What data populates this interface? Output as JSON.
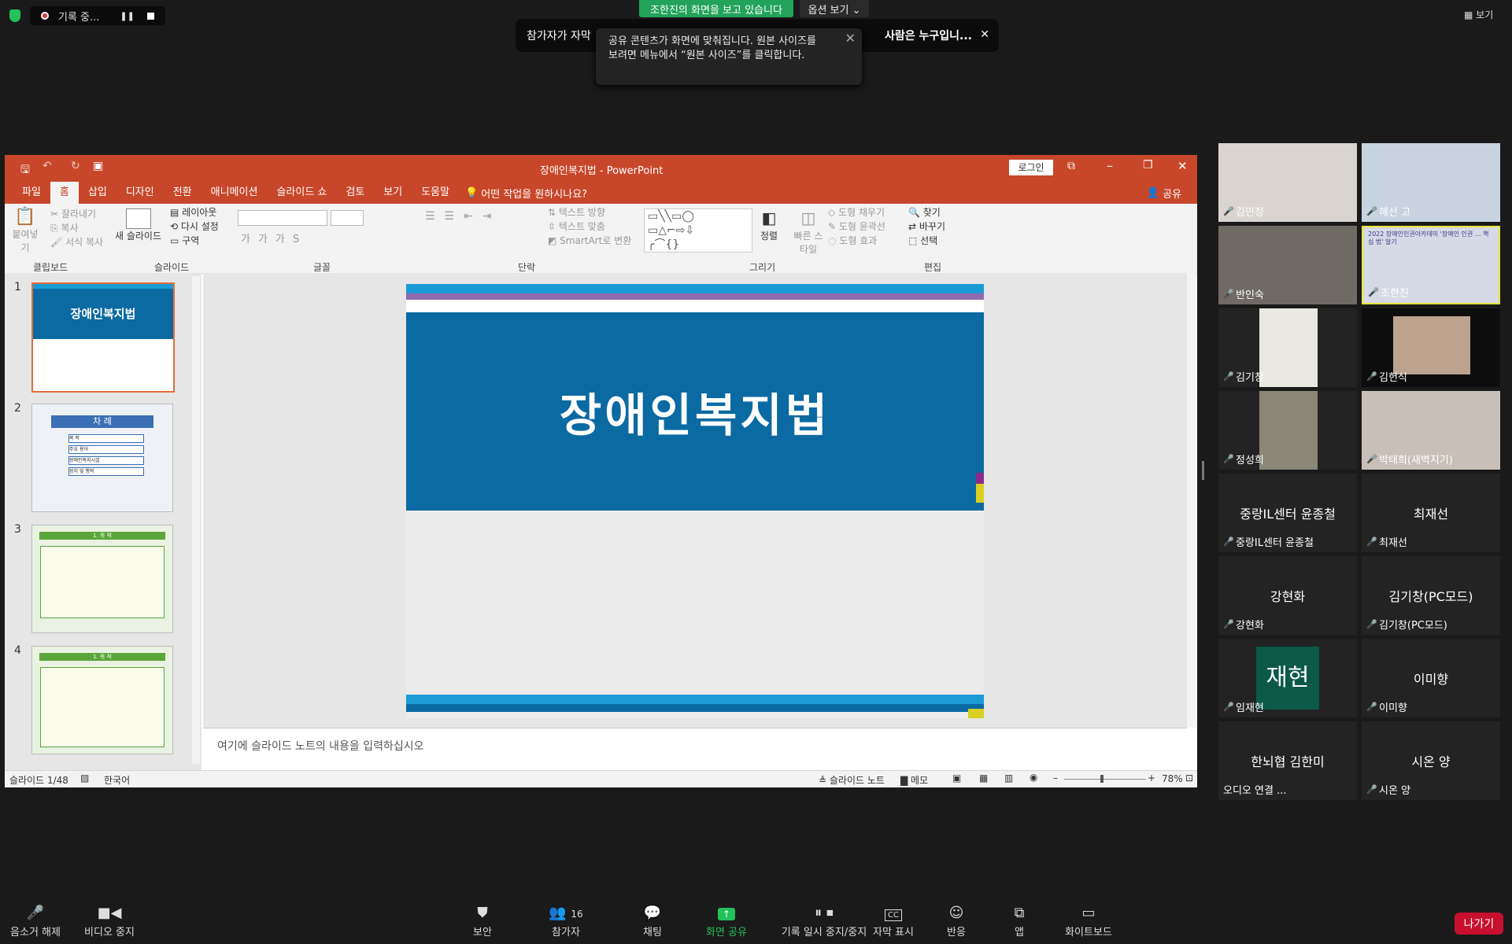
{
  "zoom_top": {
    "recording_label": "기록 중...",
    "viewing_banner": "조한진의 화면을 보고 있습니다",
    "view_options": "옵션 보기 ⌄",
    "view_label": "보기",
    "caption_left": "참가자가 자막",
    "caption_right": "사람은 누구입니...",
    "toast_line1": "공유 콘텐츠가 화면에 맞춰집니다. 원본 사이즈를",
    "toast_line2": "보려면 메뉴에서 “원본 사이즈”를 클릭합니다."
  },
  "ppt": {
    "window_title": "장애인복지법  -  PowerPoint",
    "login_button": "로그인",
    "share_label": "공유",
    "tabs": [
      "파일",
      "홈",
      "삽입",
      "디자인",
      "전환",
      "애니메이션",
      "슬라이드 쇼",
      "검토",
      "보기",
      "도움말"
    ],
    "tell_me": "어떤 작업을 원하시나요?",
    "ribbon": {
      "paste": "붙여넣기",
      "cut": "잘라내기",
      "copy": "복사",
      "format_painter": "서식 복사",
      "new_slide": "새 슬라이드",
      "layout": "레이아웃",
      "reset": "다시 설정",
      "section": "구역",
      "text_direction": "텍스트 방향",
      "align_text": "텍스트 맞춤",
      "smartart": "SmartArt로 변환",
      "arrange": "정렬",
      "quick_styles": "빠른 스타일",
      "shape_fill": "도형 채우기",
      "shape_outline": "도형 윤곽선",
      "shape_effects": "도형 효과",
      "find": "찾기",
      "replace": "바꾸기",
      "select": "선택",
      "groups": [
        "클립보드",
        "슬라이드",
        "글꼴",
        "단락",
        "그리기",
        "편집"
      ]
    },
    "thumbnails": [
      {
        "num": "1",
        "title": "장애인복지법"
      },
      {
        "num": "2",
        "title": "차 례",
        "items": [
          "목 적",
          "주요 용어",
          "장애인복지시설",
          "장치 및 행적"
        ]
      },
      {
        "num": "3",
        "title": "1. 목 적"
      },
      {
        "num": "4",
        "title": "1. 목 적"
      }
    ],
    "slide_title": "장애인복지법",
    "notes_placeholder": "여기에 슬라이드 노트의 내용을 입력하십시오",
    "status_slide": "슬라이드 1/48",
    "status_lang": "한국어",
    "status_notes": "슬라이드 노트",
    "status_memo": "메모",
    "zoom_level": "78%"
  },
  "participants": [
    {
      "name": "김민정",
      "type": "video",
      "bg": "#d9d4cf"
    },
    {
      "name": "혜선 고",
      "type": "video",
      "bg": "#c7d4e0"
    },
    {
      "name": "반인숙",
      "type": "video",
      "bg": "#6f6a64"
    },
    {
      "name": "조한진",
      "type": "video",
      "bg": "#d6d9e6",
      "active": true,
      "banner": "2022 장애인인권아카데미 '장애인 인권 ... 핵심 법' 알기"
    },
    {
      "name": "김기창",
      "type": "video",
      "bg": "#e8e8e0"
    },
    {
      "name": "김헌식",
      "type": "video",
      "bg": "#bba38e"
    },
    {
      "name": "정성희",
      "type": "video",
      "bg": "#8a8678"
    },
    {
      "name": "박태희(새벽지기)",
      "type": "video",
      "bg": "#c8c0b8"
    },
    {
      "name": "중랑IL센터 윤종철",
      "type": "name",
      "display": "중랑IL센터 윤종철"
    },
    {
      "name": "최재선",
      "type": "name",
      "display": "최재선"
    },
    {
      "name": "강현화",
      "type": "name",
      "display": "강현화"
    },
    {
      "name": "김기창(PC모드)",
      "type": "name",
      "display": "김기창(PC모드)"
    },
    {
      "name": "임재현",
      "type": "avatar",
      "display": "재현"
    },
    {
      "name": "이미향",
      "type": "name",
      "display": "이미향"
    },
    {
      "name": "오디오 연결 ...",
      "type": "name",
      "display": "한뇌협 김한미"
    },
    {
      "name": "시온 양",
      "type": "name",
      "display": "시온 양"
    }
  ],
  "toolbar": {
    "unmute": "음소거 해제",
    "stop_video": "비디오 중지",
    "security": "보안",
    "participants": "참가자",
    "participant_count": "16",
    "chat": "채팅",
    "share_screen": "화면 공유",
    "pause_recording": "기록 일시 중지/중지",
    "captions": "자막 표시",
    "reactions": "반응",
    "apps": "앱",
    "whiteboard": "화이트보드",
    "leave": "나가기"
  },
  "colors": {
    "ppt_accent": "#c8472a",
    "slide_blue": "#0b6aa2",
    "zoom_green": "#23a35a",
    "leave_red": "#c8102e"
  }
}
